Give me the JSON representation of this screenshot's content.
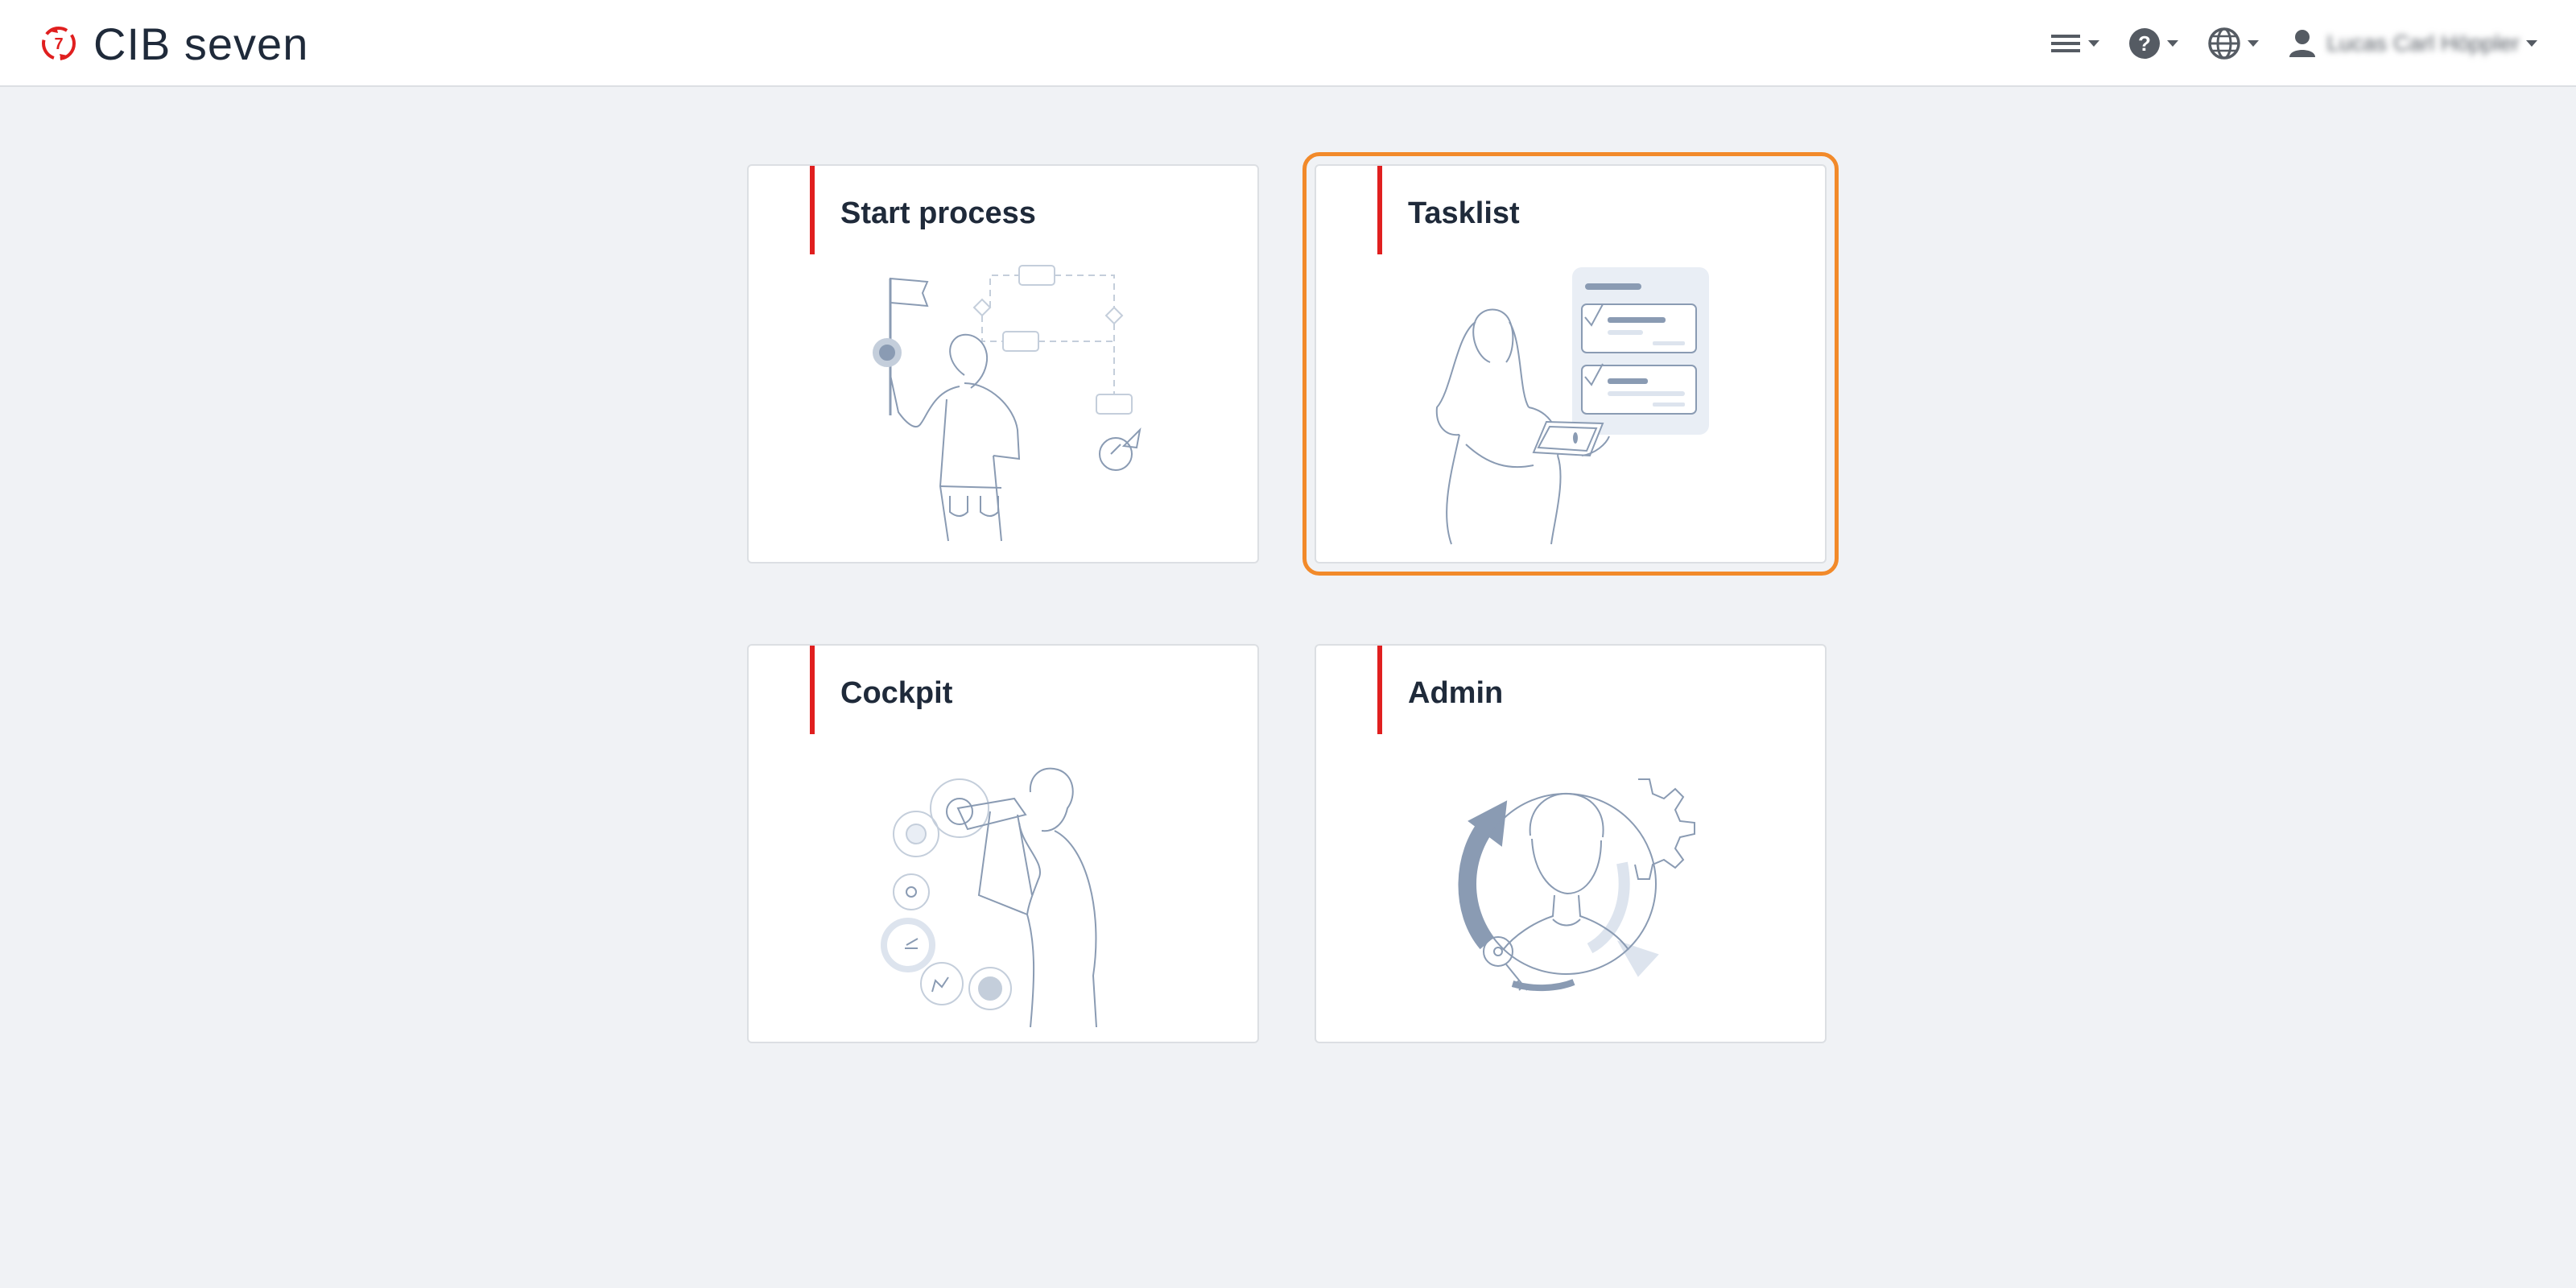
{
  "app": {
    "title": "CIB seven"
  },
  "header": {
    "user_name": "Lucas Carl Höppler",
    "menu_icon": "hamburger-menu-icon",
    "help_icon": "help-circle-icon",
    "language_icon": "globe-icon",
    "user_icon": "user-icon"
  },
  "cards": [
    {
      "title": "Start process",
      "illustration": "woman-with-flag-process-diagram"
    },
    {
      "title": "Tasklist",
      "illustration": "woman-with-tablet-task-list"
    },
    {
      "title": "Cockpit",
      "illustration": "man-with-telescope-gears"
    },
    {
      "title": "Admin",
      "illustration": "person-in-circle-with-gear-and-key"
    }
  ],
  "colors": {
    "accent": "#e01f1f",
    "focus": "#f28a2a",
    "background": "#f0f2f5",
    "text": "#1f2a3a",
    "illustration_stroke": "#8a9bb3"
  }
}
